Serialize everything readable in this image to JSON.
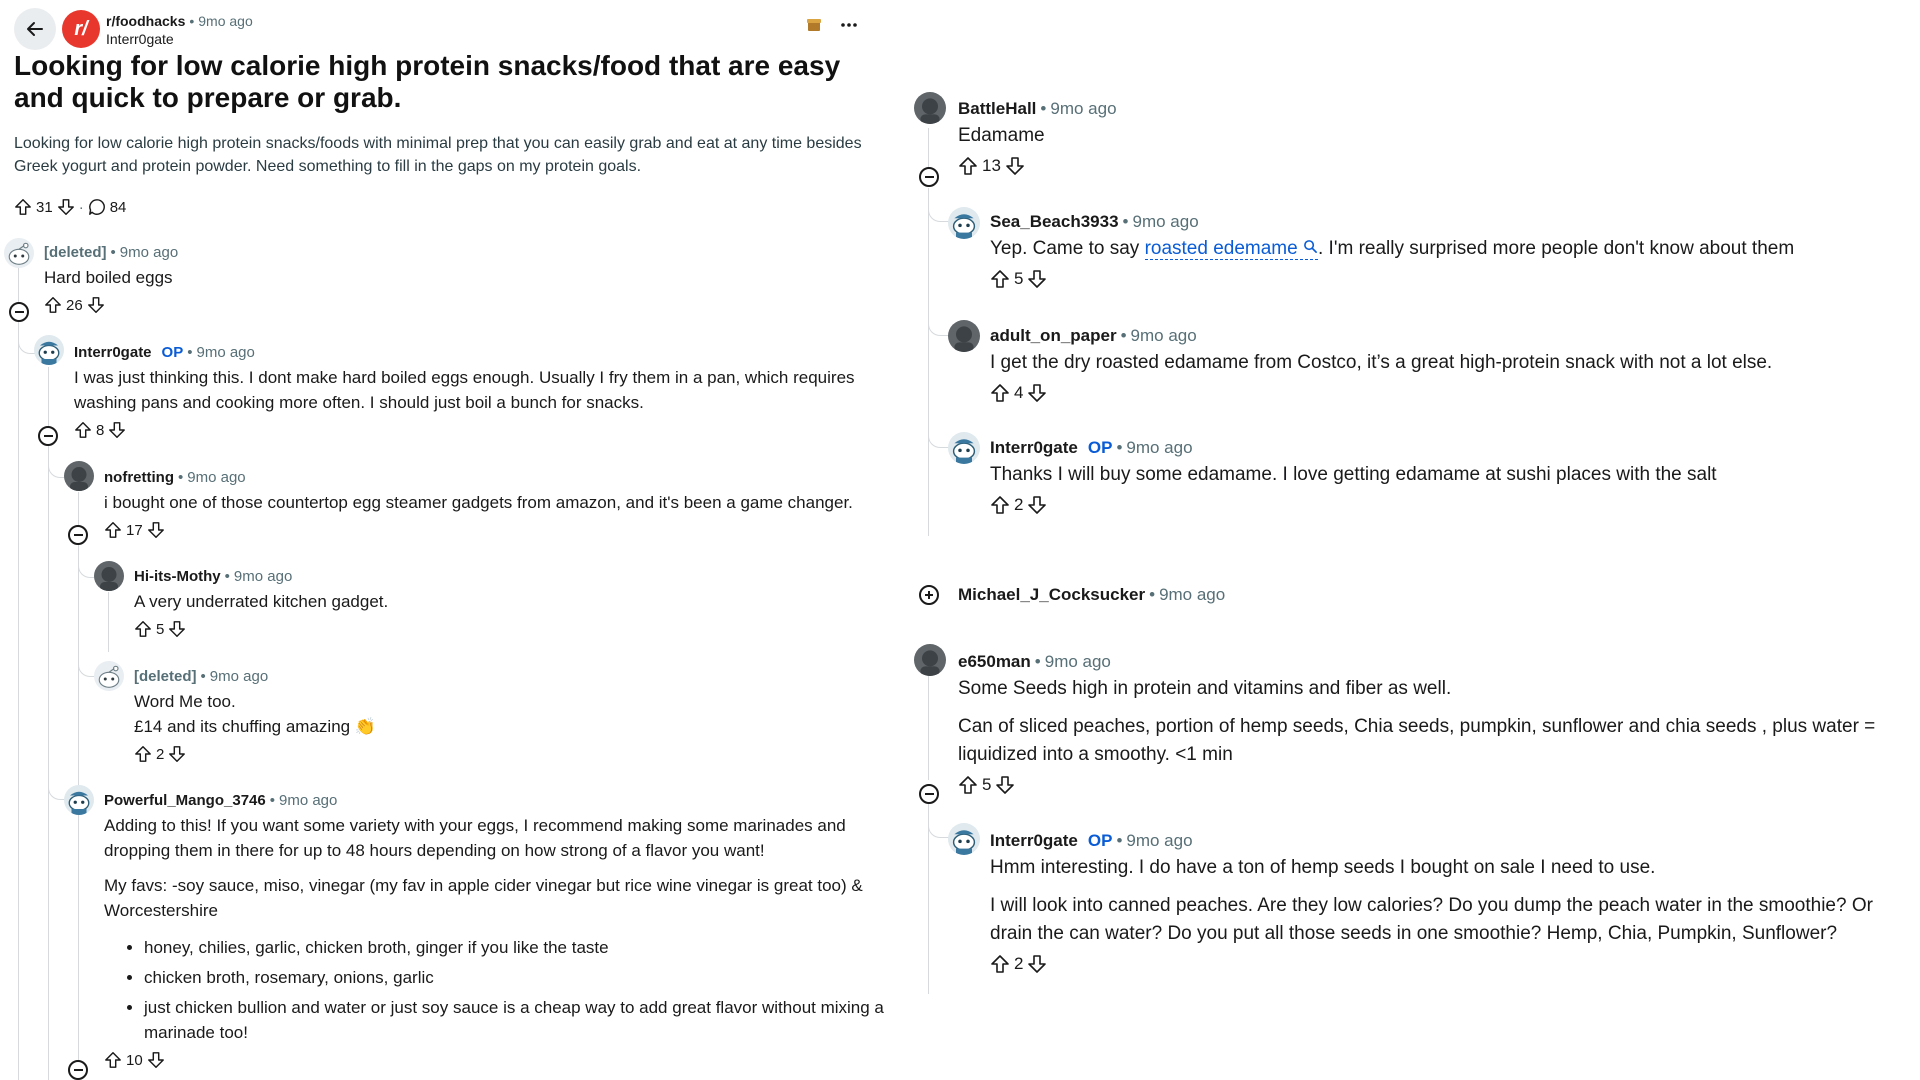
{
  "post": {
    "subreddit": "r/foodhacks",
    "time": "9mo ago",
    "author": "Interr0gate",
    "title": "Looking for low calorie high protein snacks/food that are easy and quick to prepare or grab.",
    "body": "Looking for low calorie high protein snacks/foods with minimal prep that you can easily grab and eat at any time besides Greek yogurt and protein powder. Need something to fill in the gaps on my protein goals.",
    "votes": "31",
    "comments": "84",
    "subreddit_logo_text": "r/"
  },
  "left_comments": [
    {
      "user": "[deleted]",
      "time": "9mo ago",
      "body": "Hard boiled eggs",
      "votes": "26"
    },
    {
      "user": "Interr0gate",
      "op": "OP",
      "time": "9mo ago",
      "body": "I was just thinking this. I dont make hard boiled eggs enough. Usually I fry them in a pan, which requires washing pans and cooking more often. I should just boil a bunch for snacks.",
      "votes": "8"
    },
    {
      "user": "nofretting",
      "time": "9mo ago",
      "body": "i bought one of those countertop egg steamer gadgets from amazon, and it's been a game changer.",
      "votes": "17"
    },
    {
      "user": "Hi-its-Mothy",
      "time": "9mo ago",
      "body": "A very underrated kitchen gadget.",
      "votes": "5"
    },
    {
      "user": "[deleted]",
      "time": "9mo ago",
      "body_line1": "Word Me too.",
      "body_line2": "£14 and its chuffing amazing 👏",
      "votes": "2"
    },
    {
      "user": "Powerful_Mango_3746",
      "time": "9mo ago",
      "body_p1": "Adding to this! If you want some variety with your eggs, I recommend making some marinades and dropping them in there for up to 48 hours depending on how strong of a flavor you want!",
      "body_p2": "My favs: -soy sauce, miso, vinegar (my fav in apple cider vinegar but rice wine vinegar is great too) & Worcestershire",
      "bullets": [
        "honey, chilies, garlic, chicken broth, ginger if you like the taste",
        "chicken broth, rosemary, onions, garlic",
        "just chicken bullion and water or just soy sauce is a cheap way to add great flavor without mixing a marinade too!"
      ],
      "votes": "10"
    }
  ],
  "right_comments": [
    {
      "user": "BattleHall",
      "time": "9mo ago",
      "body": "Edamame",
      "votes": "13"
    },
    {
      "user": "Sea_Beach3933",
      "time": "9mo ago",
      "body_pre": "Yep. Came to say ",
      "link": "roasted edemame",
      "body_post": ". I'm really surprised more people don't know about them",
      "votes": "5"
    },
    {
      "user": "adult_on_paper",
      "time": "9mo ago",
      "body": "I get the dry roasted edamame from Costco, it’s a great high-protein snack with not a lot else.",
      "votes": "4"
    },
    {
      "user": "Interr0gate",
      "op": "OP",
      "time": "9mo ago",
      "body": "Thanks I will buy some edamame. I love getting edamame at sushi places with the salt",
      "votes": "2"
    },
    {
      "user": "Michael_J_Cocksucker",
      "time": "9mo ago"
    },
    {
      "user": "e650man",
      "time": "9mo ago",
      "body_p1": "Some Seeds high in protein and vitamins and fiber as well.",
      "body_p2": "Can of sliced peaches, portion of hemp seeds, Chia seeds, pumpkin, sunflower and chia seeds , plus water = liquidized into a smoothy. <1 min",
      "votes": "5"
    },
    {
      "user": "Interr0gate",
      "op": "OP",
      "time": "9mo ago",
      "body_p1": "Hmm interesting. I do have a ton of hemp seeds I bought on sale I need to use.",
      "body_p2": "I will look into canned peaches. Are they low calories? Do you dump the peach water in the smoothie? Or drain the can water? Do you put all those seeds in one smoothie? Hemp, Chia, Pumpkin, Sunflower?",
      "votes": "2"
    }
  ]
}
